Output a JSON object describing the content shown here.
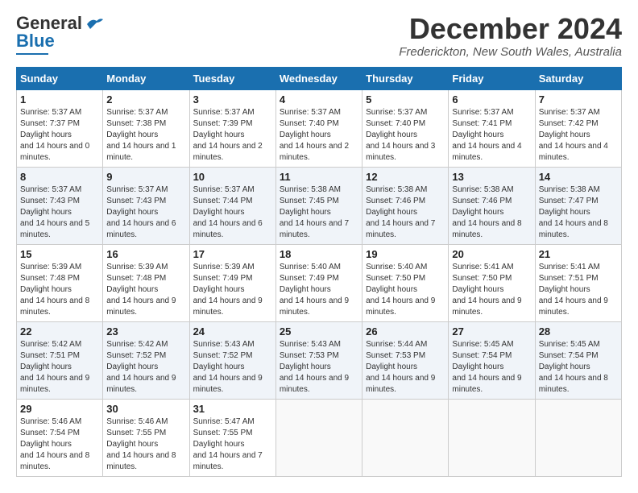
{
  "header": {
    "logo_general": "General",
    "logo_blue": "Blue",
    "month_year": "December 2024",
    "location": "Frederickton, New South Wales, Australia"
  },
  "weekdays": [
    "Sunday",
    "Monday",
    "Tuesday",
    "Wednesday",
    "Thursday",
    "Friday",
    "Saturday"
  ],
  "weeks": [
    [
      {
        "day": "1",
        "sunrise": "5:37 AM",
        "sunset": "7:37 PM",
        "daylight": "14 hours and 0 minutes."
      },
      {
        "day": "2",
        "sunrise": "5:37 AM",
        "sunset": "7:38 PM",
        "daylight": "14 hours and 1 minute."
      },
      {
        "day": "3",
        "sunrise": "5:37 AM",
        "sunset": "7:39 PM",
        "daylight": "14 hours and 2 minutes."
      },
      {
        "day": "4",
        "sunrise": "5:37 AM",
        "sunset": "7:40 PM",
        "daylight": "14 hours and 2 minutes."
      },
      {
        "day": "5",
        "sunrise": "5:37 AM",
        "sunset": "7:40 PM",
        "daylight": "14 hours and 3 minutes."
      },
      {
        "day": "6",
        "sunrise": "5:37 AM",
        "sunset": "7:41 PM",
        "daylight": "14 hours and 4 minutes."
      },
      {
        "day": "7",
        "sunrise": "5:37 AM",
        "sunset": "7:42 PM",
        "daylight": "14 hours and 4 minutes."
      }
    ],
    [
      {
        "day": "8",
        "sunrise": "5:37 AM",
        "sunset": "7:43 PM",
        "daylight": "14 hours and 5 minutes."
      },
      {
        "day": "9",
        "sunrise": "5:37 AM",
        "sunset": "7:43 PM",
        "daylight": "14 hours and 6 minutes."
      },
      {
        "day": "10",
        "sunrise": "5:37 AM",
        "sunset": "7:44 PM",
        "daylight": "14 hours and 6 minutes."
      },
      {
        "day": "11",
        "sunrise": "5:38 AM",
        "sunset": "7:45 PM",
        "daylight": "14 hours and 7 minutes."
      },
      {
        "day": "12",
        "sunrise": "5:38 AM",
        "sunset": "7:46 PM",
        "daylight": "14 hours and 7 minutes."
      },
      {
        "day": "13",
        "sunrise": "5:38 AM",
        "sunset": "7:46 PM",
        "daylight": "14 hours and 8 minutes."
      },
      {
        "day": "14",
        "sunrise": "5:38 AM",
        "sunset": "7:47 PM",
        "daylight": "14 hours and 8 minutes."
      }
    ],
    [
      {
        "day": "15",
        "sunrise": "5:39 AM",
        "sunset": "7:48 PM",
        "daylight": "14 hours and 8 minutes."
      },
      {
        "day": "16",
        "sunrise": "5:39 AM",
        "sunset": "7:48 PM",
        "daylight": "14 hours and 9 minutes."
      },
      {
        "day": "17",
        "sunrise": "5:39 AM",
        "sunset": "7:49 PM",
        "daylight": "14 hours and 9 minutes."
      },
      {
        "day": "18",
        "sunrise": "5:40 AM",
        "sunset": "7:49 PM",
        "daylight": "14 hours and 9 minutes."
      },
      {
        "day": "19",
        "sunrise": "5:40 AM",
        "sunset": "7:50 PM",
        "daylight": "14 hours and 9 minutes."
      },
      {
        "day": "20",
        "sunrise": "5:41 AM",
        "sunset": "7:50 PM",
        "daylight": "14 hours and 9 minutes."
      },
      {
        "day": "21",
        "sunrise": "5:41 AM",
        "sunset": "7:51 PM",
        "daylight": "14 hours and 9 minutes."
      }
    ],
    [
      {
        "day": "22",
        "sunrise": "5:42 AM",
        "sunset": "7:51 PM",
        "daylight": "14 hours and 9 minutes."
      },
      {
        "day": "23",
        "sunrise": "5:42 AM",
        "sunset": "7:52 PM",
        "daylight": "14 hours and 9 minutes."
      },
      {
        "day": "24",
        "sunrise": "5:43 AM",
        "sunset": "7:52 PM",
        "daylight": "14 hours and 9 minutes."
      },
      {
        "day": "25",
        "sunrise": "5:43 AM",
        "sunset": "7:53 PM",
        "daylight": "14 hours and 9 minutes."
      },
      {
        "day": "26",
        "sunrise": "5:44 AM",
        "sunset": "7:53 PM",
        "daylight": "14 hours and 9 minutes."
      },
      {
        "day": "27",
        "sunrise": "5:45 AM",
        "sunset": "7:54 PM",
        "daylight": "14 hours and 9 minutes."
      },
      {
        "day": "28",
        "sunrise": "5:45 AM",
        "sunset": "7:54 PM",
        "daylight": "14 hours and 8 minutes."
      }
    ],
    [
      {
        "day": "29",
        "sunrise": "5:46 AM",
        "sunset": "7:54 PM",
        "daylight": "14 hours and 8 minutes."
      },
      {
        "day": "30",
        "sunrise": "5:46 AM",
        "sunset": "7:55 PM",
        "daylight": "14 hours and 8 minutes."
      },
      {
        "day": "31",
        "sunrise": "5:47 AM",
        "sunset": "7:55 PM",
        "daylight": "14 hours and 7 minutes."
      },
      null,
      null,
      null,
      null
    ]
  ]
}
